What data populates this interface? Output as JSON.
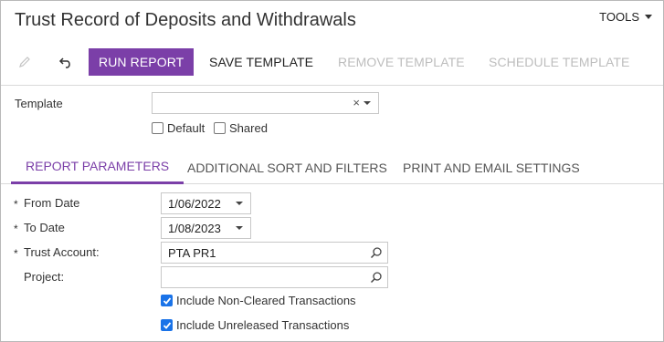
{
  "header": {
    "title": "Trust Record of Deposits and Withdrawals",
    "tools_label": "TOOLS"
  },
  "toolbar": {
    "edit_icon": "pencil-icon",
    "undo_icon": "undo-icon",
    "run_label": "RUN REPORT",
    "save_label": "SAVE TEMPLATE",
    "remove_label": "REMOVE TEMPLATE",
    "schedule_label": "SCHEDULE TEMPLATE"
  },
  "template": {
    "label": "Template",
    "value": "",
    "clear_glyph": "×",
    "default_label": "Default",
    "shared_label": "Shared",
    "default_checked": false,
    "shared_checked": false
  },
  "tabs": [
    {
      "label": "REPORT PARAMETERS",
      "active": true
    },
    {
      "label": "ADDITIONAL SORT AND FILTERS",
      "active": false
    },
    {
      "label": "PRINT AND EMAIL SETTINGS",
      "active": false
    }
  ],
  "params": {
    "from_date_label": "From Date",
    "from_date_value": "1/06/2022",
    "to_date_label": "To Date",
    "to_date_value": "1/08/2023",
    "trust_account_label": "Trust Account:",
    "trust_account_value": "PTA PR1",
    "project_label": "Project:",
    "project_value": "",
    "required_mark": "*",
    "non_cleared_label": "Include Non-Cleared Transactions",
    "non_cleared_checked": true,
    "unreleased_label": "Include Unreleased Transactions",
    "unreleased_checked": true
  },
  "colors": {
    "accent": "#7b3fa8",
    "checkbox_on": "#1a73e8"
  }
}
